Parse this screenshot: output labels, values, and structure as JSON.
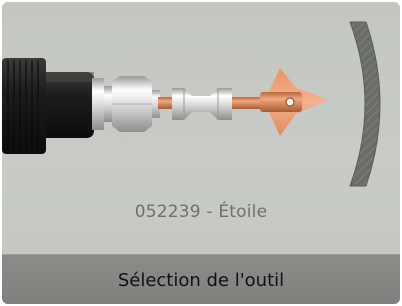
{
  "tool": {
    "code": "052239",
    "separator": " - ",
    "name": "Étoile",
    "caption": "052239 - Étoile"
  },
  "bottom_bar": {
    "label": "Sélection de l'outil"
  },
  "colors": {
    "screen_background": "#c8cbc6",
    "bottom_bar_background": "#848683",
    "copper": "#d98a5f",
    "chrome": "#e6e6e6",
    "drill_body": "#1e1f1e",
    "star_cutter": "#f2a37a",
    "arc_guard": "#6a6c69",
    "caption_text": "#6e706d"
  },
  "icons": {
    "drill": "drill-chuck-icon",
    "coupling": "hex-coupling-icon",
    "extension": "spool-extension-icon",
    "cutter": "star-cutter-icon",
    "guard": "arc-guard-icon"
  }
}
